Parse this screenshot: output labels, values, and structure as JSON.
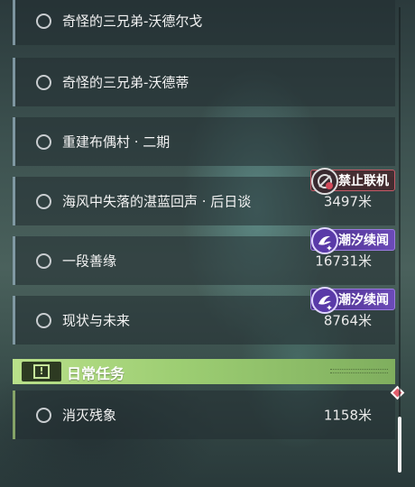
{
  "quests": [
    {
      "title": "奇怪的三兄弟-沃德尔戈",
      "distance": ""
    },
    {
      "title": "奇怪的三兄弟-沃德蒂",
      "distance": ""
    },
    {
      "title": "重建布偶村 · 二期",
      "distance": ""
    },
    {
      "title": "海风中失落的湛蓝回声 · 后日谈",
      "distance": "3497米",
      "tag": {
        "label": "禁止联机",
        "type": "banned",
        "icon": "no-multiplayer-icon"
      }
    },
    {
      "title": "一段善缘",
      "distance": "16731米",
      "tag": {
        "label": "潮汐续闻",
        "type": "tide",
        "icon": "tide-story-icon"
      }
    },
    {
      "title": "现状与未来",
      "distance": "8764米",
      "tag": {
        "label": "潮汐续闻",
        "type": "tide",
        "icon": "tide-story-icon"
      }
    }
  ],
  "daily_section": {
    "title": "日常任务",
    "icon": "alert-icon",
    "icon_symbol": "!",
    "quests": [
      {
        "title": "消灭残象",
        "distance": "1158米"
      }
    ]
  },
  "colors": {
    "section_green": "#9ccd72",
    "banned_red": "#c85a68",
    "tide_purple": "#6b4ab8",
    "track_marker": "#e25d6c"
  }
}
